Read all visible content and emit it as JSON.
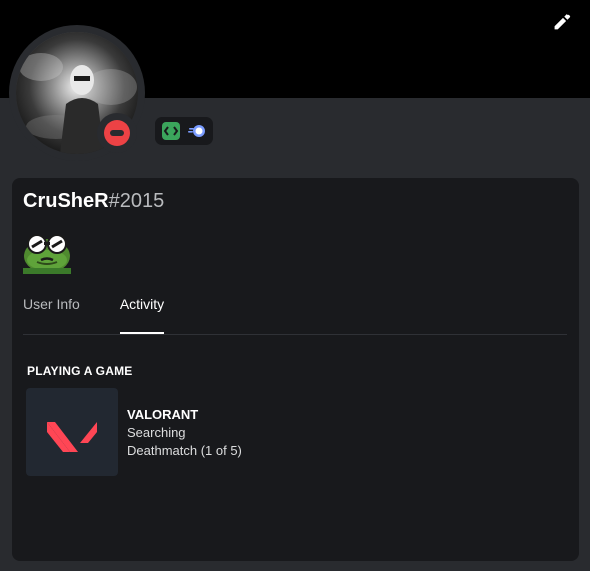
{
  "profile": {
    "username": "CruSheR",
    "discriminator": "#2015",
    "status": "Do Not Disturb",
    "badges": [
      "hypesquad-icon",
      "nitro-icon"
    ],
    "emoji": "pepe-sunglasses-emoji"
  },
  "tabs": [
    {
      "label": "User Info",
      "active": false
    },
    {
      "label": "Activity",
      "active": true
    }
  ],
  "activity": {
    "header": "PLAYING A GAME",
    "game": "VALORANT",
    "state": "Searching",
    "details": "Deathmatch (1 of 5)"
  },
  "colors": {
    "banner": "#000000",
    "background": "#292b2f",
    "card": "#18191c",
    "dnd": "#ed4245",
    "valorant": "#ff4655",
    "badge_green": "#3ba55c",
    "badge_nitro": "#7a9cff"
  },
  "icons": {
    "edit": "pencil-icon"
  }
}
